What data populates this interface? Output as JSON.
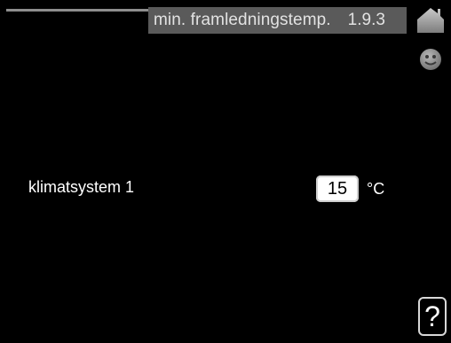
{
  "header": {
    "title": "min. framledningstemp.",
    "menu_number": "1.9.3"
  },
  "icons": {
    "home": "house-icon",
    "smiley": "smiley-icon",
    "help": "help-icon"
  },
  "setting": {
    "label": "klimatsystem 1",
    "value": "15",
    "unit": "°C"
  },
  "help": {
    "symbol": "?"
  },
  "colors": {
    "background": "#000000",
    "title_bar": "#5a5a5a",
    "icon_gray": "#8f8f8f"
  }
}
